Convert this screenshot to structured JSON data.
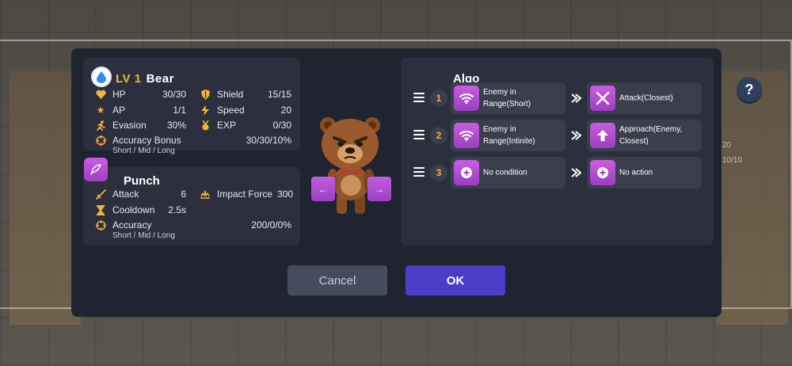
{
  "background": {
    "readout_1": "20",
    "readout_2": "10/10",
    "help_label": "?"
  },
  "character": {
    "level_label": "LV 1",
    "name": "Bear",
    "stats": [
      {
        "icon": "heart-icon",
        "label": "HP",
        "value": "30/30"
      },
      {
        "icon": "star-icon",
        "label": "AP",
        "value": "1/1"
      },
      {
        "icon": "running-icon",
        "label": "Evasion",
        "value": "30%"
      },
      {
        "icon": "shield-icon",
        "label": "Shield",
        "value": "15/15"
      },
      {
        "icon": "lightning-icon",
        "label": "Speed",
        "value": "20"
      },
      {
        "icon": "medal-icon",
        "label": "EXP",
        "value": "0/30"
      }
    ],
    "accuracy_bonus_label": "Accuracy Bonus",
    "accuracy_bonus_value": "30/30/10%",
    "accuracy_bonus_ranges": "Short / Mid / Long"
  },
  "skill": {
    "name": "Punch",
    "attack_label": "Attack",
    "attack_value": "6",
    "impact_label": "Impact Force",
    "impact_value": "300",
    "cooldown_label": "Cooldown",
    "cooldown_value": "2.5s",
    "accuracy_label": "Accuracy",
    "accuracy_value": "200/0/0%",
    "accuracy_ranges": "Short / Mid / Long"
  },
  "portrait": {
    "prev_label": "←",
    "next_label": "→"
  },
  "algo": {
    "title": "Algo",
    "rows": [
      {
        "number": "1",
        "condition": "Enemy in Range(Short)",
        "condition_icon": "wifi-icon",
        "action": "Attack(Closest)",
        "action_icon": "crossed-swords-icon"
      },
      {
        "number": "2",
        "condition": "Enemy in Range(Intinite)",
        "condition_icon": "wifi-icon",
        "action": "Approach(Enemy, Closest)",
        "action_icon": "up-arrow-icon"
      },
      {
        "number": "3",
        "condition": "No condition",
        "condition_icon": "plus-icon",
        "action": "No action",
        "action_icon": "plus-icon"
      }
    ]
  },
  "buttons": {
    "cancel": "Cancel",
    "ok": "OK"
  },
  "colors": {
    "accent_gold": "#f2b43a",
    "accent_purple": "#b44fd6",
    "ok_button": "#4a3ec7",
    "cancel_button": "#454c5d",
    "dialog_bg": "#202431",
    "card_bg": "#2c303e"
  }
}
